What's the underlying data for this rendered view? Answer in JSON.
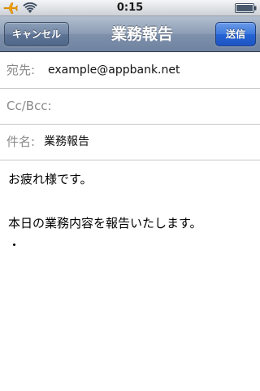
{
  "status_bar": {
    "time": "0:15",
    "icons": [
      "airplane-icon",
      "wifi-icon",
      "battery-icon"
    ],
    "accent_color": "#f5a000"
  },
  "nav": {
    "cancel_label": "キャンセル",
    "title": "業務報告",
    "send_label": "送信"
  },
  "fields": {
    "to_label": "宛先:",
    "to_value": "example@appbank.net",
    "cc_label": "Cc/Bcc:",
    "subject_label": "件名:",
    "subject_value": "業務報告"
  },
  "body": {
    "line1": "お疲れ様です。",
    "line2": "本日の業務内容を報告いたします。",
    "line3": "・"
  },
  "colors": {
    "nav_bar": "#7f91ab",
    "send_button": "#2563d4",
    "label_gray": "#8a8a8a"
  }
}
